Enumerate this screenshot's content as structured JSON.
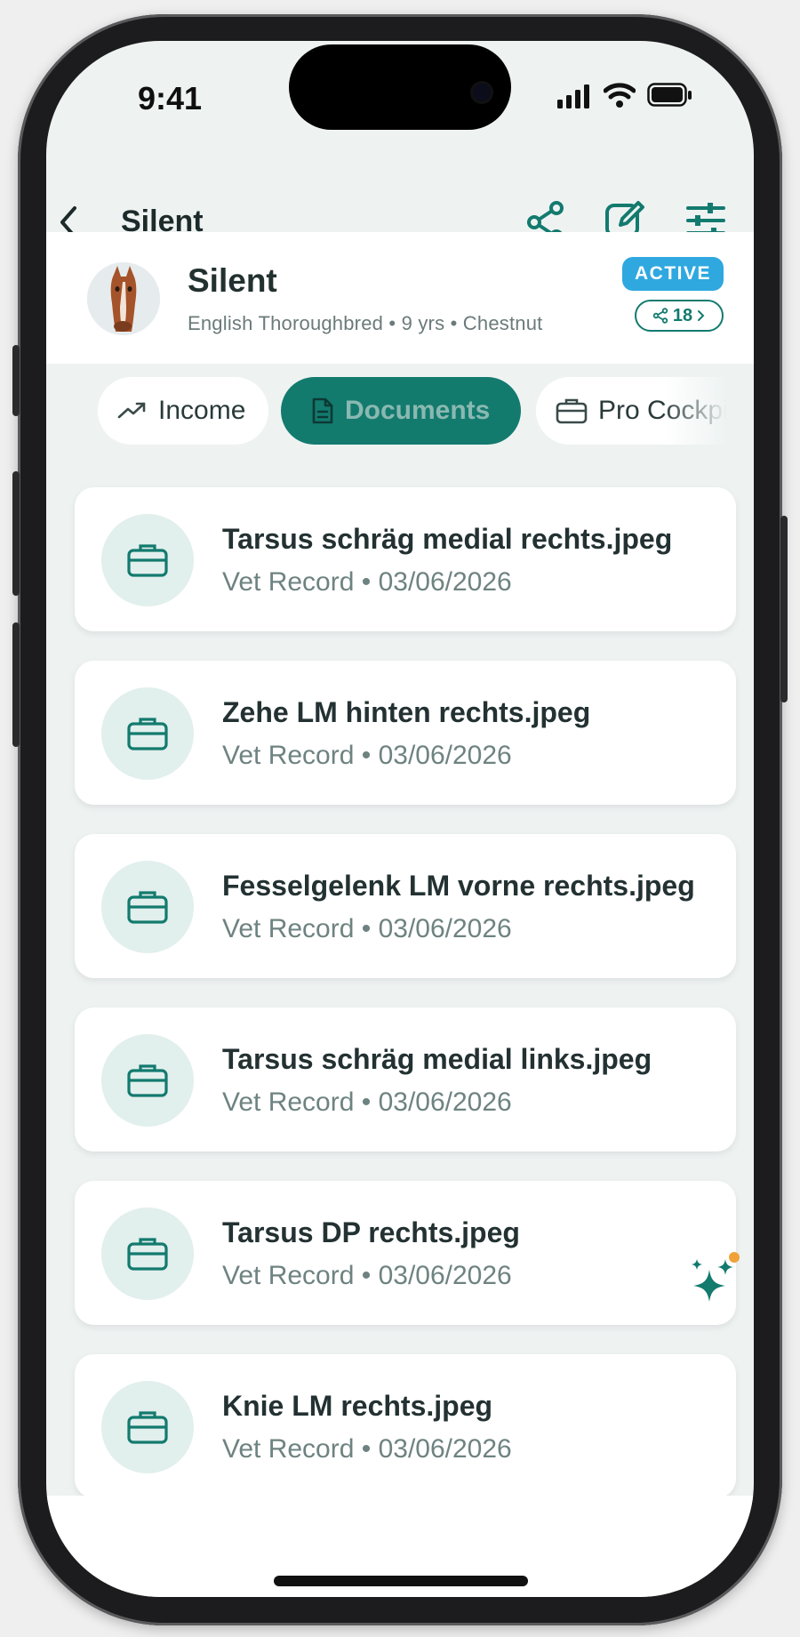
{
  "status_bar": {
    "time": "9:41"
  },
  "navbar": {
    "title": "Silent",
    "icons": [
      "back-chevron-icon",
      "share-icon",
      "edit-icon",
      "filter-sliders-icon"
    ]
  },
  "profile": {
    "name": "Silent",
    "subtitle": "English Thoroughbred • 9 yrs • Chestnut",
    "status_badge": "ACTIVE",
    "share_count": "18"
  },
  "tabs": [
    {
      "label": "Income",
      "icon": "trending-up-icon",
      "active": false
    },
    {
      "label": "Documents",
      "icon": "document-icon",
      "active": true
    },
    {
      "label": "Pro Cockpit",
      "icon": "briefcase-icon",
      "active": false
    }
  ],
  "documents": [
    {
      "title": "Tarsus schräg medial rechts.jpeg",
      "meta": "Vet Record • 03/06/2026"
    },
    {
      "title": "Zehe LM hinten rechts.jpeg",
      "meta": "Vet Record • 03/06/2026"
    },
    {
      "title": "Fesselgelenk LM vorne rechts.jpeg",
      "meta": "Vet Record • 03/06/2026"
    },
    {
      "title": "Tarsus schräg medial links.jpeg",
      "meta": "Vet Record • 03/06/2026"
    },
    {
      "title": "Tarsus DP rechts.jpeg",
      "meta": "Vet Record • 03/06/2026"
    },
    {
      "title": "Knie LM rechts.jpeg",
      "meta": "Vet Record • 03/06/2026"
    }
  ],
  "colors": {
    "accent": "#137a6e",
    "badge": "#2fa8e0",
    "background": "#eef3f2"
  }
}
